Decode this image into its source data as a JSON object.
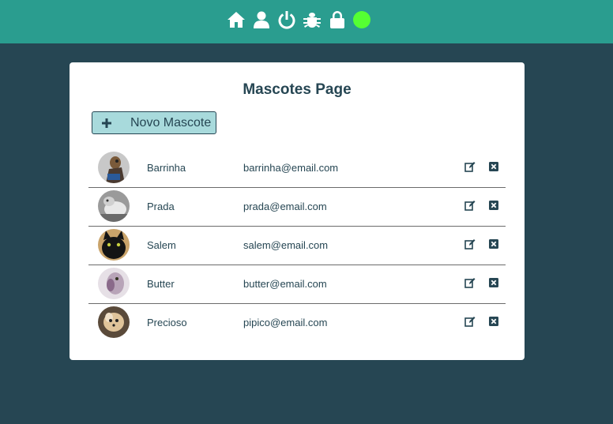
{
  "nav": {
    "icons": [
      "home-icon",
      "user-icon",
      "power-icon",
      "bug-icon",
      "lock-icon"
    ],
    "status_color": "#55ff33"
  },
  "page": {
    "title": "Mascotes Page",
    "new_button_label": "Novo Mascote"
  },
  "pets": [
    {
      "name": "Barrinha",
      "email": "barrinha@email.com"
    },
    {
      "name": "Prada",
      "email": "prada@email.com"
    },
    {
      "name": "Salem",
      "email": "salem@email.com"
    },
    {
      "name": "Butter",
      "email": "butter@email.com"
    },
    {
      "name": "Precioso",
      "email": "pipico@email.com"
    }
  ],
  "colors": {
    "header": "#2a9d8f",
    "background": "#264653",
    "button": "#a8dadc",
    "text": "#264653"
  }
}
